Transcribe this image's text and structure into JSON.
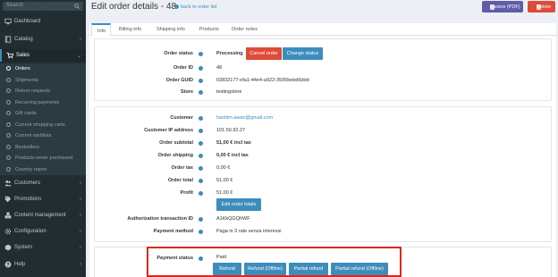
{
  "sidebar": {
    "search_placeholder": "Search",
    "items": [
      {
        "label": "Dashboard",
        "icon": "desktop-icon",
        "has_chevron": false
      },
      {
        "label": "Catalog",
        "icon": "book-icon",
        "has_chevron": true
      },
      {
        "label": "Sales",
        "icon": "cart-icon",
        "has_chevron": true,
        "active": true
      },
      {
        "label": "Customers",
        "icon": "users-icon",
        "has_chevron": true
      },
      {
        "label": "Promotions",
        "icon": "tag-icon",
        "has_chevron": true
      },
      {
        "label": "Content management",
        "icon": "cubes-icon",
        "has_chevron": true
      },
      {
        "label": "Configuration",
        "icon": "gears-icon",
        "has_chevron": true
      },
      {
        "label": "System",
        "icon": "cube-icon",
        "has_chevron": true
      },
      {
        "label": "Help",
        "icon": "question-icon",
        "has_chevron": true
      }
    ],
    "sales_sub": [
      "Orders",
      "Shipments",
      "Return requests",
      "Recurring payments",
      "Gift cards",
      "Current shopping carts",
      "Current wishlists",
      "Bestsellers",
      "Products never purchased",
      "Country report"
    ]
  },
  "header": {
    "title": "Edit order details - 48",
    "back_link": "back to order list",
    "invoice_btn": "Invoice (PDF)",
    "delete_btn": "Delete"
  },
  "tabs": [
    "Info",
    "Billing info",
    "Shipping info",
    "Products",
    "Order notes"
  ],
  "order": {
    "status_label": "Order status",
    "status_value": "Processing",
    "cancel_btn": "Cancel order",
    "change_btn": "Change status",
    "id_label": "Order ID",
    "id_value": "48",
    "guid_label": "Order GUID",
    "guid_value": "03832177-efa1-44e4-a922-3505bebd6ddd",
    "store_label": "Store",
    "store_value": "testingstore"
  },
  "details": {
    "customer_label": "Customer",
    "customer_value": "hashim.awan@gmail.com",
    "ip_label": "Customer IP address",
    "ip_value": "101.50.92.27",
    "subtotal_label": "Order subtotal",
    "subtotal_value": "51,00 € incl tax",
    "shipping_label": "Order shipping",
    "shipping_value": "0,00 € incl tax",
    "tax_label": "Order tax",
    "tax_value": "0,00 €",
    "total_label": "Order total",
    "total_value": "51,00 €",
    "profit_label": "Profit",
    "profit_value": "51,00 €",
    "edit_totals_btn": "Edit order totals",
    "auth_label": "Authorization transaction ID",
    "auth_value": "A1KkQGQhWF",
    "method_label": "Payment method",
    "method_value": "Paga in 3 rate senza interessi"
  },
  "payment": {
    "status_label": "Payment status",
    "status_value": "Paid",
    "buttons": [
      "Refund",
      "Refund (Offline)",
      "Partial refund",
      "Partial refund (Offline)"
    ]
  },
  "colors": {
    "sidebar_bg": "#222d32",
    "accent_blue": "#3c8dbc",
    "danger_red": "#dd4b39",
    "invoice_purple": "#605ca8",
    "highlight_red": "#d9281f"
  }
}
